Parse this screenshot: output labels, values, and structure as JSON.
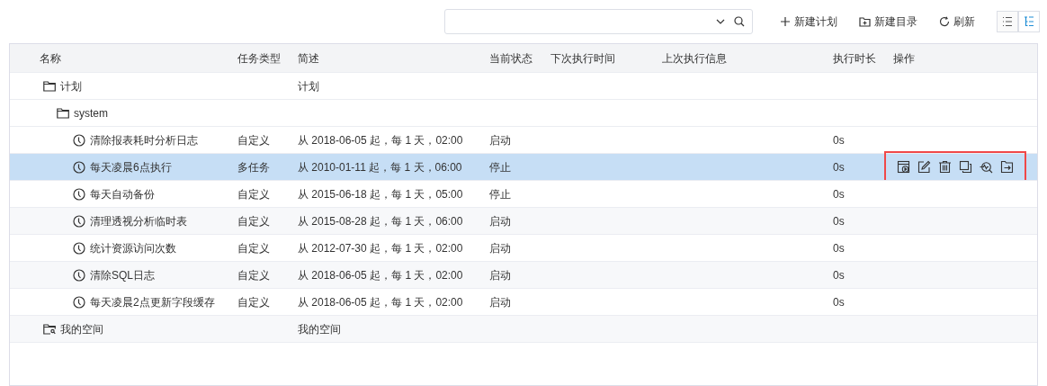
{
  "toolbar": {
    "search": {
      "dropdown": true
    },
    "buttons": [
      {
        "kind": "add",
        "label": "新建计划"
      },
      {
        "kind": "folder",
        "label": "新建目录"
      },
      {
        "kind": "refresh",
        "label": "刷新"
      }
    ],
    "views": [
      {
        "kind": "list",
        "selected": false
      },
      {
        "kind": "tree",
        "selected": true
      }
    ]
  },
  "table": {
    "columns": [
      "名称",
      "任务类型",
      "简述",
      "当前状态",
      "下次执行时间",
      "上次执行信息",
      "执行时长",
      "操作"
    ],
    "row_actions": [
      {
        "kind": "run"
      },
      {
        "kind": "edit"
      },
      {
        "kind": "delete"
      },
      {
        "kind": "copy"
      },
      {
        "kind": "monitor"
      },
      {
        "kind": "move"
      }
    ],
    "rows": [
      {
        "kind": "folder",
        "name": "计划",
        "description": "计划",
        "children": [
          {
            "kind": "folder",
            "name": "system",
            "children": [
              {
                "kind": "task",
                "name": "清除报表耗时分析日志",
                "type": "自定义",
                "description": "从 2018-06-05 起，每 1 天，02:00",
                "state": "启动",
                "duration": "0s",
                "selected": false
              },
              {
                "kind": "task",
                "name": "每天凌晨6点执行",
                "type": "多任务",
                "description": "从 2010-01-11 起，每 1 天，06:00",
                "state": "停止",
                "duration": "0s",
                "selected": true,
                "highlighted": true
              },
              {
                "kind": "task",
                "name": "每天自动备份",
                "type": "自定义",
                "description": "从 2015-06-18 起，每 1 天，05:00",
                "state": "停止",
                "duration": "0s",
                "selected": false
              },
              {
                "kind": "task",
                "name": "清理透视分析临时表",
                "type": "自定义",
                "description": "从 2015-08-28 起，每 1 天，06:00",
                "state": "启动",
                "duration": "0s",
                "selected": false
              },
              {
                "kind": "task",
                "name": "统计资源访问次数",
                "type": "自定义",
                "description": "从 2012-07-30 起，每 1 天，02:00",
                "state": "启动",
                "duration": "0s",
                "selected": false
              },
              {
                "kind": "task",
                "name": "清除SQL日志",
                "type": "自定义",
                "description": "从 2018-06-05 起，每 1 天，02:00",
                "state": "启动",
                "duration": "0s",
                "selected": false
              },
              {
                "kind": "task",
                "name": "每天凌晨2点更新字段缓存",
                "type": "自定义",
                "description": "从 2018-06-05 起，每 1 天，02:00",
                "state": "启动",
                "duration": "0s",
                "selected": false
              }
            ]
          }
        ]
      },
      {
        "kind": "user-folder",
        "name": "我的空间",
        "description": "我的空间"
      }
    ]
  }
}
